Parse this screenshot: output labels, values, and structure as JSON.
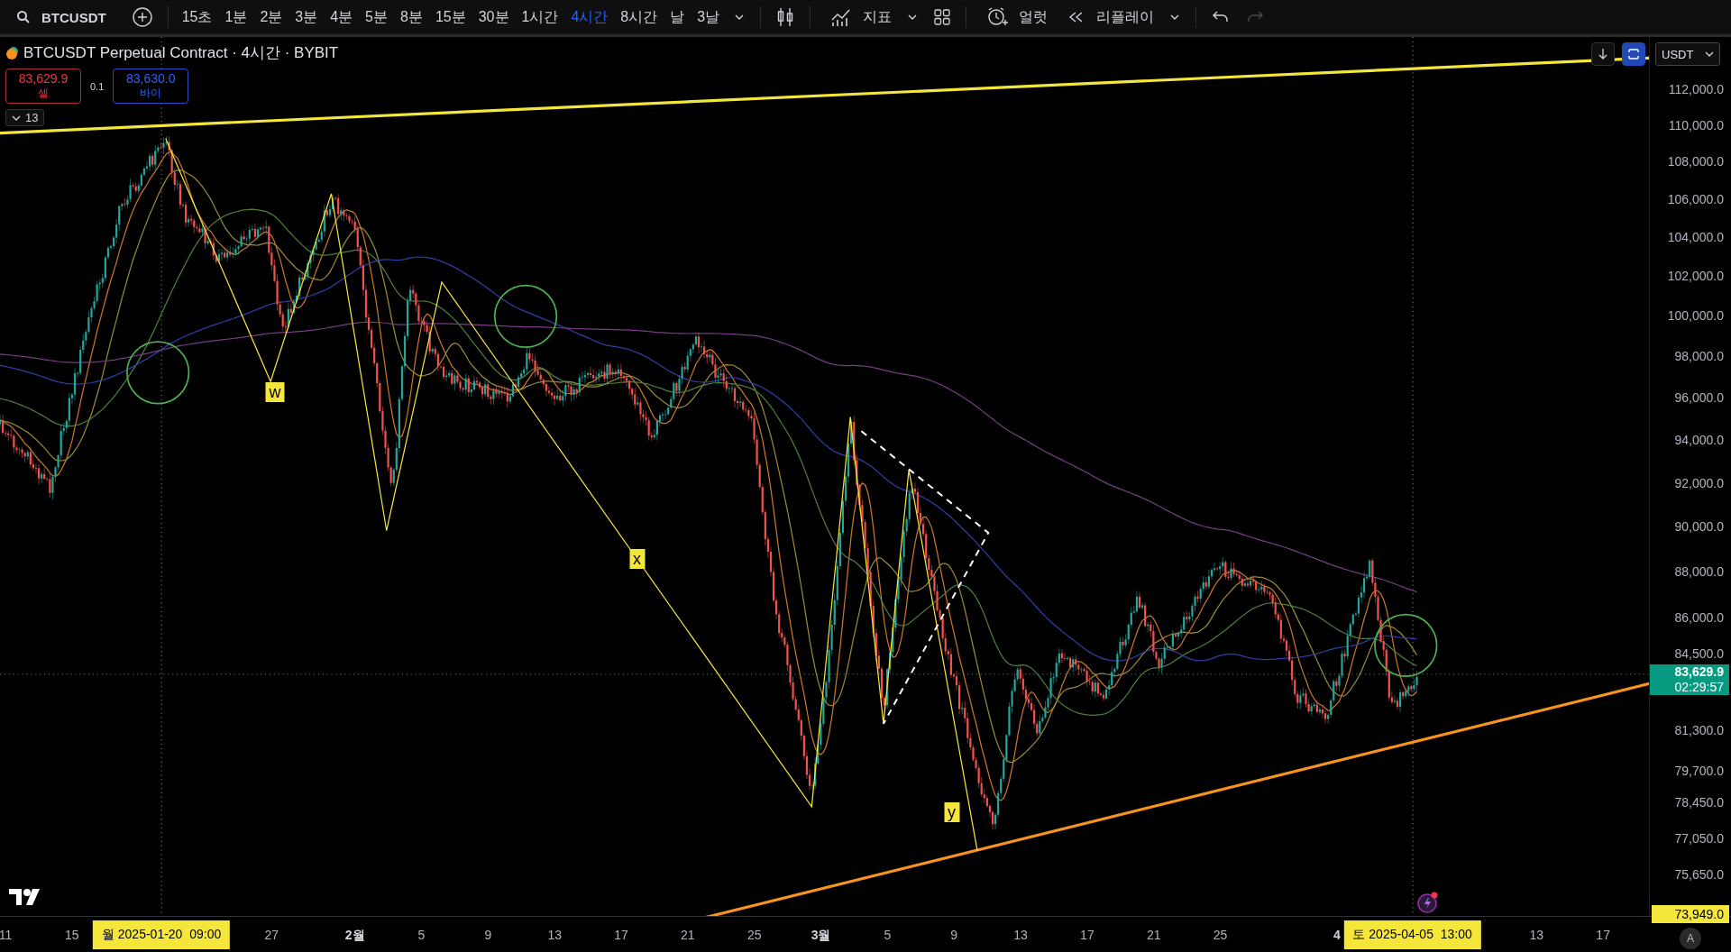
{
  "toolbar": {
    "symbol": "BTCUSDT",
    "intervals": [
      {
        "label": "15초",
        "selected": false
      },
      {
        "label": "1분",
        "selected": false
      },
      {
        "label": "2분",
        "selected": false
      },
      {
        "label": "3분",
        "selected": false
      },
      {
        "label": "4분",
        "selected": false
      },
      {
        "label": "5분",
        "selected": false
      },
      {
        "label": "8분",
        "selected": false
      },
      {
        "label": "15분",
        "selected": false
      },
      {
        "label": "30분",
        "selected": false
      },
      {
        "label": "1시간",
        "selected": false
      },
      {
        "label": "4시간",
        "selected": true
      },
      {
        "label": "8시간",
        "selected": false
      },
      {
        "label": "날",
        "selected": false
      },
      {
        "label": "3날",
        "selected": false
      }
    ],
    "indicators_label": "지표",
    "alert_label": "얼럿",
    "replay_label": "리플레이",
    "redo_disabled": true
  },
  "legend": {
    "title": "BTCUSDT Perpetual Contract · 4시간 · BYBIT",
    "sell_price": "83,629.9",
    "sell_label": "셀",
    "spread": "0.1",
    "buy_price": "83,630.0",
    "buy_label": "바이",
    "indicator_count": "13"
  },
  "wave_labels": [
    "w",
    "x",
    "y"
  ],
  "price_axis": {
    "currency": "USDT",
    "labels": [
      "112,000.0",
      "110,000.0",
      "108,000.0",
      "106,000.0",
      "104,000.0",
      "102,000.0",
      "100,000.0",
      "98,000.0",
      "96,000.0",
      "94,000.0",
      "92,000.0",
      "90,000.0",
      "88,000.0",
      "86,000.0",
      "84,500.0",
      "81,300.0",
      "79,700.0",
      "78,450.0",
      "77,050.0",
      "75,650.0"
    ],
    "last_price": "83,629.9",
    "countdown": "02:29:57",
    "marker_price": "73,949.0",
    "auto_scale_label": "A"
  },
  "time_axis": {
    "labels": [
      {
        "text": "11",
        "kind": "day"
      },
      {
        "text": "15",
        "kind": "day"
      },
      {
        "text": "27",
        "kind": "day"
      },
      {
        "text": "2월",
        "kind": "month"
      },
      {
        "text": "5",
        "kind": "day"
      },
      {
        "text": "9",
        "kind": "day"
      },
      {
        "text": "13",
        "kind": "day"
      },
      {
        "text": "17",
        "kind": "day"
      },
      {
        "text": "21",
        "kind": "day"
      },
      {
        "text": "25",
        "kind": "day"
      },
      {
        "text": "3월",
        "kind": "month"
      },
      {
        "text": "5",
        "kind": "day"
      },
      {
        "text": "9",
        "kind": "day"
      },
      {
        "text": "13",
        "kind": "day"
      },
      {
        "text": "17",
        "kind": "day"
      },
      {
        "text": "21",
        "kind": "day"
      },
      {
        "text": "25",
        "kind": "day"
      },
      {
        "text": "4",
        "kind": "month"
      },
      {
        "text": "13",
        "kind": "day"
      },
      {
        "text": "17",
        "kind": "day"
      }
    ],
    "crosshair_labels": [
      "월 2025-01-20  09:00",
      "토 2025-04-05  13:00"
    ]
  }
}
